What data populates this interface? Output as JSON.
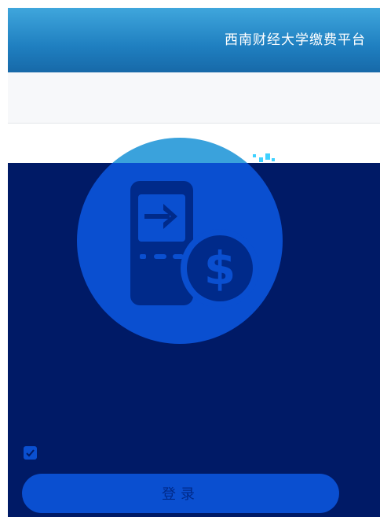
{
  "header": {
    "title": "西南财经大学缴费平台"
  },
  "logo": {
    "icon": "mobile-payment-icon",
    "currency_symbol": "$"
  },
  "form": {
    "remember_checked": true,
    "login_label": "登录"
  },
  "colors": {
    "header_blue": "#1f7fc0",
    "overlay_navy": "#001a66",
    "logo_blue": "#0a4fd0"
  }
}
